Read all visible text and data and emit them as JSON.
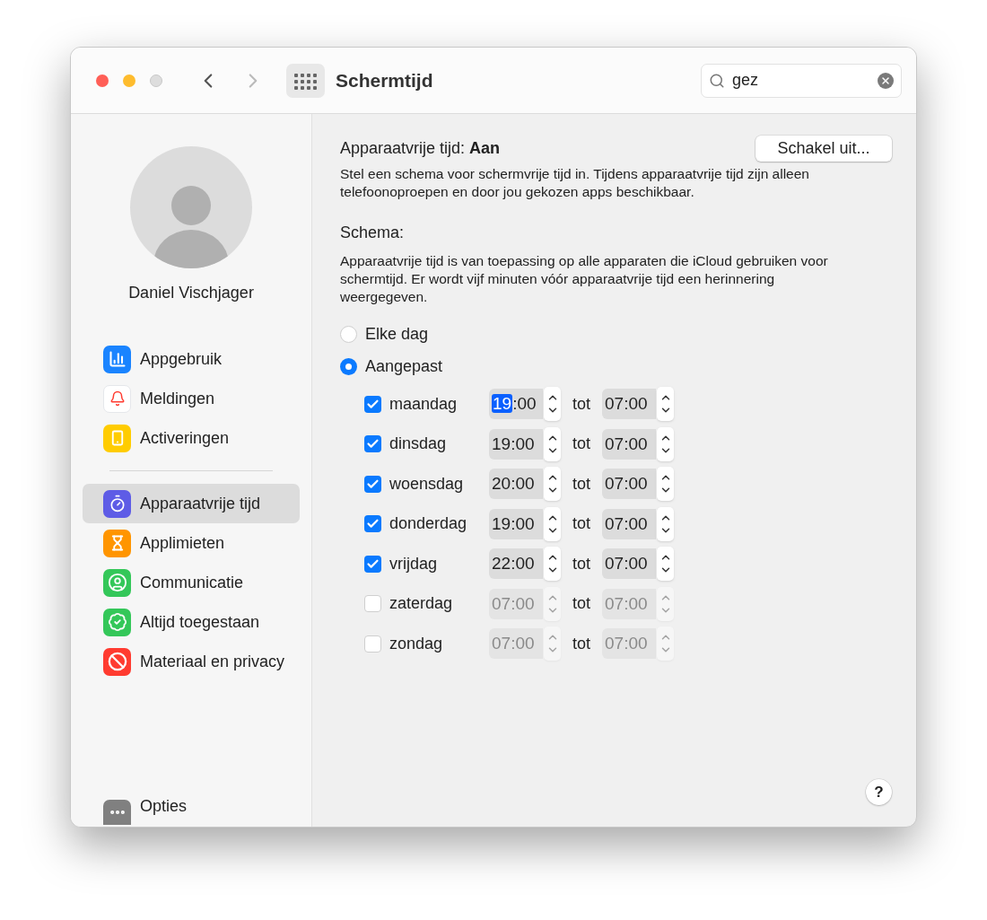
{
  "window": {
    "title": "Schermtijd"
  },
  "search": {
    "value": "gez"
  },
  "sidebar": {
    "user_name": "Daniel Vischjager",
    "groups": [
      [
        {
          "label": "Appgebruik",
          "selected": false
        },
        {
          "label": "Meldingen",
          "selected": false
        },
        {
          "label": "Activeringen",
          "selected": false
        }
      ],
      [
        {
          "label": "Apparaatvrije tijd",
          "selected": true
        },
        {
          "label": "Applimieten",
          "selected": false
        },
        {
          "label": "Communicatie",
          "selected": false
        },
        {
          "label": "Altijd toegestaan",
          "selected": false
        },
        {
          "label": "Materiaal en privacy",
          "selected": false
        }
      ]
    ],
    "options": {
      "label": "Opties"
    }
  },
  "main": {
    "status_label": "Apparaatvrije tijd:",
    "status_value": "Aan",
    "toggle_button": "Schakel uit...",
    "intro": "Stel een schema voor schermvrije tijd in. Tijdens apparaatvrije tijd zijn alleen telefoonoproepen en door jou gekozen apps beschikbaar.",
    "schedule_heading": "Schema:",
    "schedule_text": "Apparaatvrije tijd is van toepassing op alle apparaten die iCloud gebruiken voor schermtijd. Er wordt vijf minuten vóór apparaatvrije tijd een herinnering weergegeven.",
    "modes": [
      {
        "label": "Elke dag",
        "selected": false
      },
      {
        "label": "Aangepast",
        "selected": true
      }
    ],
    "days": [
      {
        "label": "maandag",
        "checked": true,
        "start": "19:00",
        "start_hours_selected": true,
        "separator": "tot",
        "end": "07:00"
      },
      {
        "label": "dinsdag",
        "checked": true,
        "start": "19:00",
        "start_hours_selected": false,
        "separator": "tot",
        "end": "07:00"
      },
      {
        "label": "woensdag",
        "checked": true,
        "start": "20:00",
        "start_hours_selected": false,
        "separator": "tot",
        "end": "07:00"
      },
      {
        "label": "donderdag",
        "checked": true,
        "start": "19:00",
        "start_hours_selected": false,
        "separator": "tot",
        "end": "07:00"
      },
      {
        "label": "vrijdag",
        "checked": true,
        "start": "22:00",
        "start_hours_selected": false,
        "separator": "tot",
        "end": "07:00"
      },
      {
        "label": "zaterdag",
        "checked": false,
        "start": "07:00",
        "start_hours_selected": false,
        "separator": "tot",
        "end": "07:00"
      },
      {
        "label": "zondag",
        "checked": false,
        "start": "07:00",
        "start_hours_selected": false,
        "separator": "tot",
        "end": "07:00"
      }
    ],
    "help_button": "?"
  }
}
